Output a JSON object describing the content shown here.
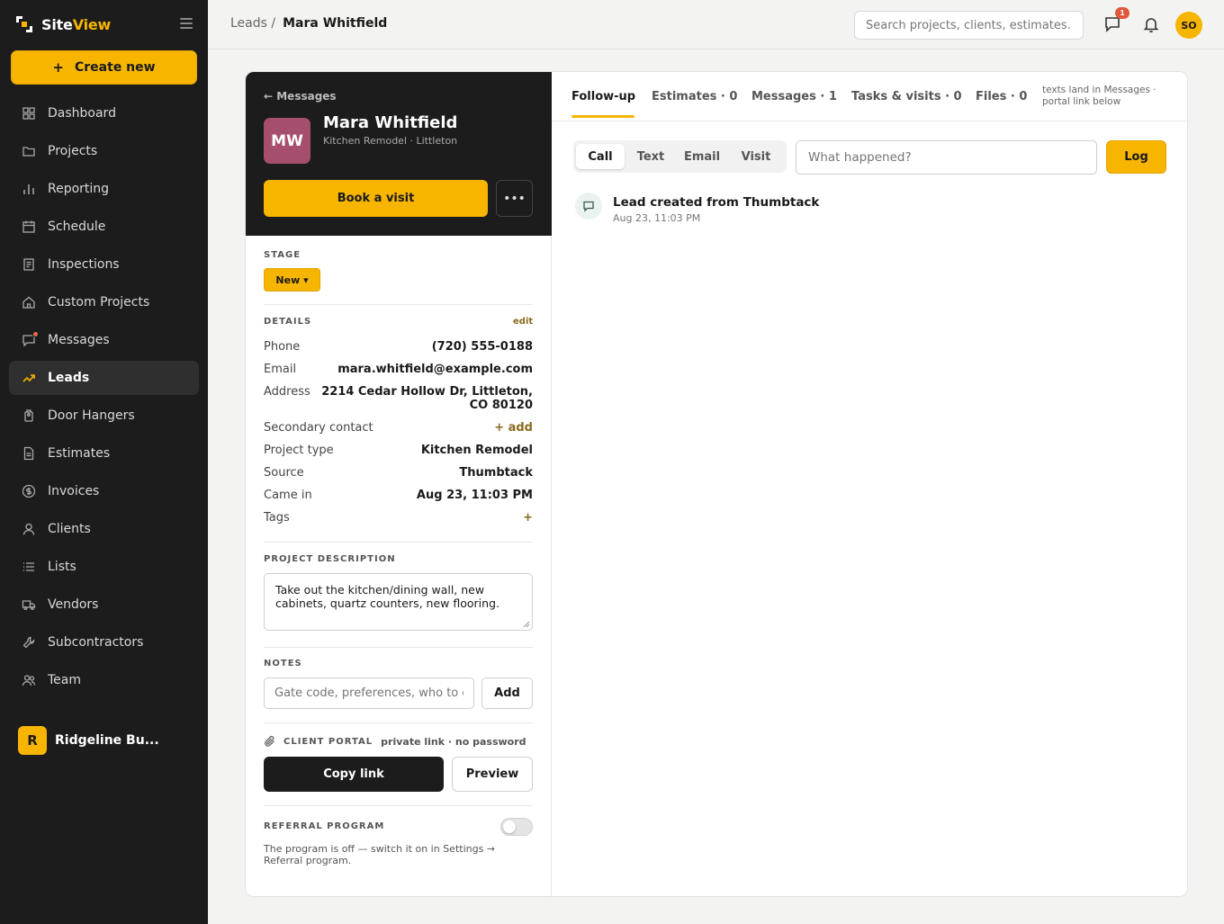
{
  "brand": {
    "name_part1": "Site",
    "name_part2": "View",
    "accent_color": "#f7b500"
  },
  "sidebar": {
    "create_label": "Create new",
    "items": [
      {
        "label": "Dashboard",
        "icon": "grid-icon"
      },
      {
        "label": "Projects",
        "icon": "folder-icon"
      },
      {
        "label": "Reporting",
        "icon": "bar-chart-icon"
      },
      {
        "label": "Schedule",
        "icon": "calendar-icon"
      },
      {
        "label": "Inspections",
        "icon": "document-icon"
      },
      {
        "label": "Custom Projects",
        "icon": "home-icon"
      },
      {
        "label": "Messages",
        "icon": "chat-icon"
      },
      {
        "label": "Leads",
        "icon": "trending-up-icon",
        "active": true
      },
      {
        "label": "Door Hangers",
        "icon": "tag-icon"
      },
      {
        "label": "Estimates",
        "icon": "file-icon"
      },
      {
        "label": "Invoices",
        "icon": "dollar-icon"
      },
      {
        "label": "Clients",
        "icon": "user-icon"
      },
      {
        "label": "Lists",
        "icon": "list-icon"
      },
      {
        "label": "Vendors",
        "icon": "truck-icon"
      },
      {
        "label": "Subcontractors",
        "icon": "wrench-icon"
      },
      {
        "label": "Team",
        "icon": "team-icon"
      }
    ],
    "org": {
      "initial": "R",
      "name": "Ridgeline Bu..."
    }
  },
  "topbar": {
    "breadcrumb_parent": "Leads /",
    "breadcrumb_current": "Mara Whitfield",
    "search_placeholder": "Search projects, clients, estimates...",
    "chat_badge": "1",
    "user_initials": "SO"
  },
  "lead": {
    "back_label": "← Messages",
    "initials": "MW",
    "name": "Mara Whitfield",
    "subtitle": "Kitchen Remodel · Littleton",
    "book_label": "Book a visit",
    "more_label": "•••",
    "stage_label": "STAGE",
    "stage_value": "New ▾",
    "details_label": "DETAILS",
    "edit_label": "edit",
    "details": {
      "phone_label": "Phone",
      "phone": "(720) 555-0188",
      "email_label": "Email",
      "email": "mara.whitfield@example.com",
      "address_label": "Address",
      "address_line1": "2214 Cedar Hollow Dr, Littleton,",
      "address_line2": "CO 80120",
      "secondary_label": "Secondary contact",
      "secondary_action": "+ add",
      "project_type_label": "Project type",
      "project_type": "Kitchen Remodel",
      "source_label": "Source",
      "source": "Thumbtack",
      "came_in_label": "Came in",
      "came_in": "Aug 23, 11:03 PM",
      "tags_label": "Tags",
      "tags_action": "+"
    },
    "description_label": "PROJECT DESCRIPTION",
    "description": "Take out the kitchen/dining wall, new cabinets, quartz counters, new flooring.",
    "notes_label": "NOTES",
    "notes_placeholder": "Gate code, preferences, who to call",
    "notes_add": "Add",
    "portal_label": "CLIENT PORTAL",
    "portal_note": "private link · no password",
    "copy_label": "Copy link",
    "preview_label": "Preview",
    "referral_label": "REFERRAL PROGRAM",
    "referral_enabled": false,
    "referral_text": "The program is off — switch it on in Settings → Referral program."
  },
  "activity": {
    "tabs": [
      {
        "label": "Follow-up",
        "active": true
      },
      {
        "label": "Estimates · 0"
      },
      {
        "label": "Messages · 1"
      },
      {
        "label": "Tasks & visits · 0"
      },
      {
        "label": "Files · 0"
      }
    ],
    "tab_note_line1": "texts land in Messages ·",
    "tab_note_line2": "portal link below",
    "modes": [
      "Call",
      "Text",
      "Email",
      "Visit"
    ],
    "active_mode": "Call",
    "input_placeholder": "What happened?",
    "log_label": "Log",
    "events": [
      {
        "title": "Lead created from Thumbtack",
        "time": "Aug 23, 11:03 PM",
        "icon": "chat-icon"
      }
    ]
  }
}
